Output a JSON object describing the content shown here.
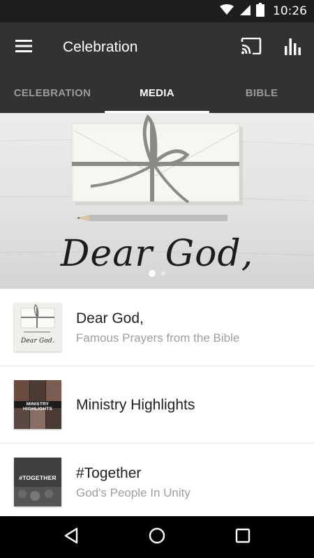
{
  "status_bar": {
    "time": "10:26",
    "icons": [
      "wifi-icon",
      "signal-icon",
      "battery-icon"
    ]
  },
  "app_bar": {
    "title": "Celebration",
    "menu_icon": "hamburger-menu-icon",
    "actions": [
      "cast-icon",
      "stats-icon"
    ]
  },
  "tabs": [
    {
      "label": "CELEBRATION",
      "active": false
    },
    {
      "label": "MEDIA",
      "active": true
    },
    {
      "label": "BIBLE",
      "active": false
    }
  ],
  "hero": {
    "title": "Dear God,",
    "page_count": 2,
    "active_page": 1
  },
  "media_items": [
    {
      "title": "Dear God,",
      "subtitle": "Famous Prayers from the Bible",
      "thumb_text": "Dear God."
    },
    {
      "title": "Ministry Highlights",
      "subtitle": "",
      "thumb_text": "MINISTRY HIGHLIGHTS"
    },
    {
      "title": "#Together",
      "subtitle": "God's People In Unity",
      "thumb_text": "#TOGETHER"
    }
  ],
  "nav_bar": {
    "icons": [
      "back-icon",
      "home-icon",
      "recents-icon"
    ]
  },
  "colors": {
    "app_bar": "#323232",
    "status_bar": "#1e1e1e",
    "nav_bar": "#000000",
    "subtitle": "#9e9e9e"
  }
}
